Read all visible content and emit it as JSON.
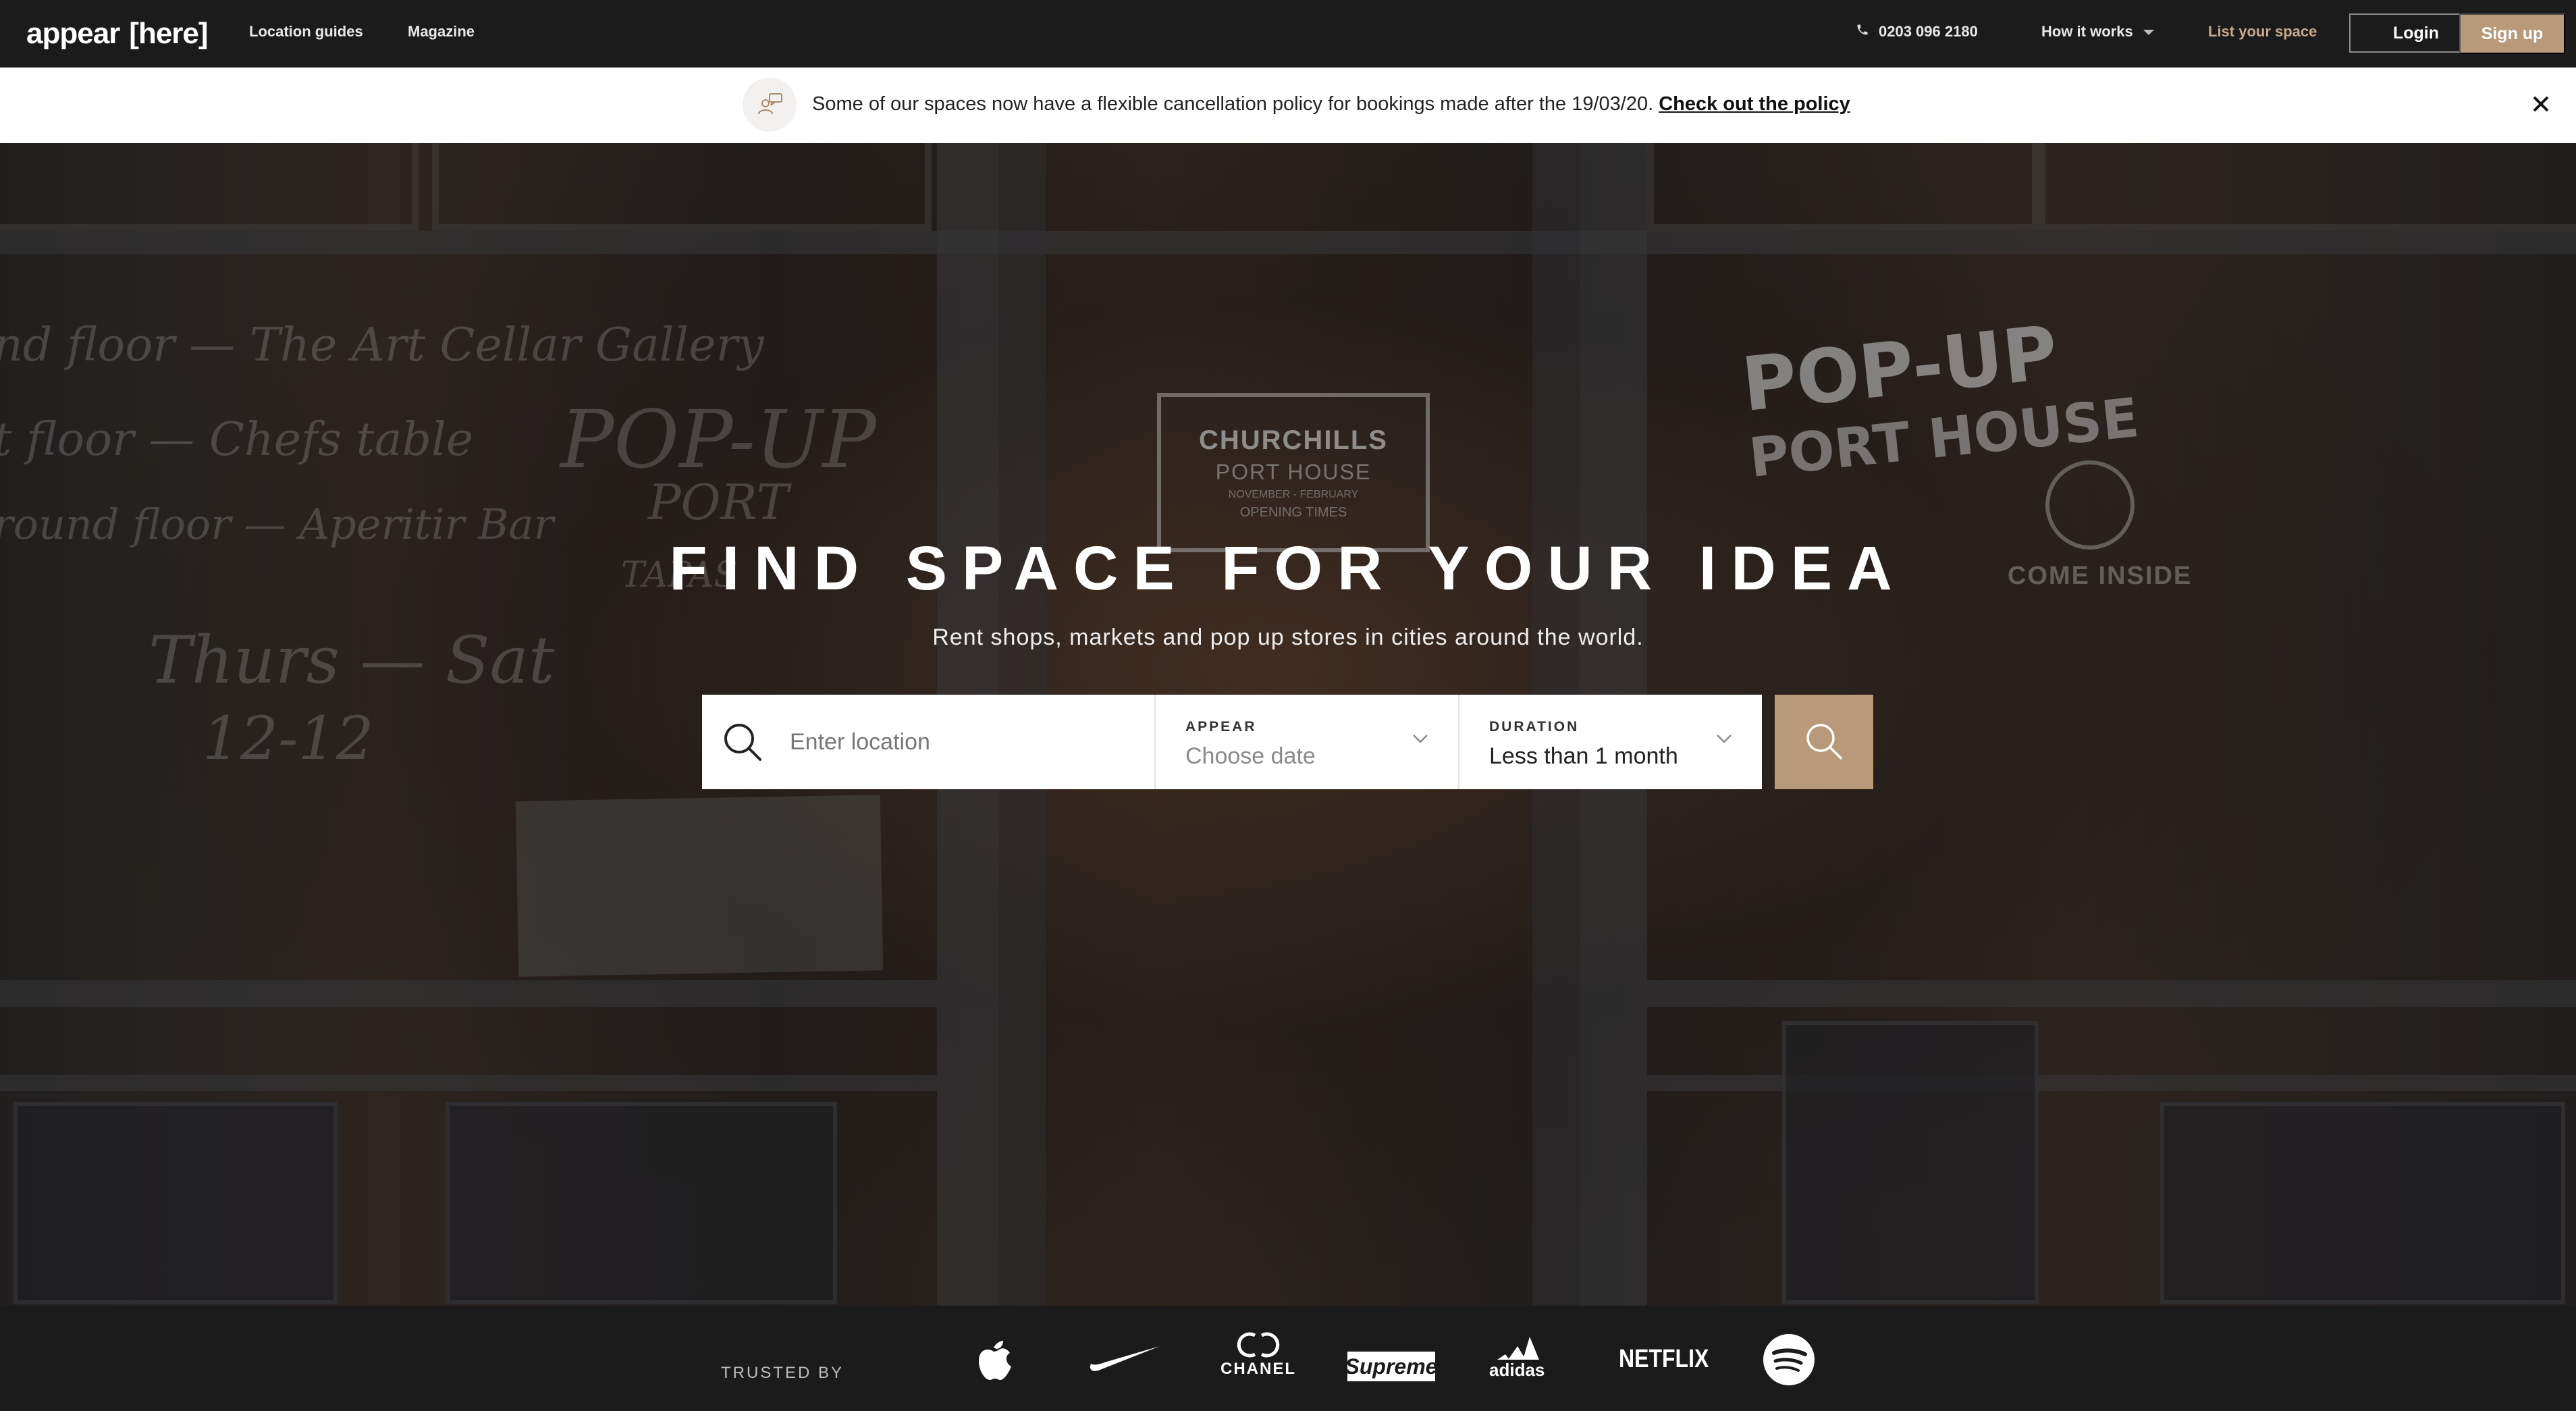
{
  "header": {
    "logo_word": "appear",
    "logo_bracket": "[here]",
    "nav": [
      "Location guides",
      "Magazine"
    ],
    "phone": "0203 096 2180",
    "how_it_works": "How it works",
    "list_space": "List your space",
    "login": "Login",
    "signup": "Sign up"
  },
  "notice": {
    "text": "Some of our spaces now have a flexible cancellation policy for bookings made after the 19/03/20.",
    "link": "Check out the policy"
  },
  "hero": {
    "title": "FIND SPACE FOR YOUR IDEA",
    "subtitle": "Rent shops, markets and pop up stores in cities around the world.",
    "chalk_left": [
      "nd floor — The Art Cellar Gallery",
      "t floor — Chefs table",
      "round floor — Aperitir Bar",
      "Thurs — Sat",
      "12-12"
    ],
    "chalk_mid": [
      "POP-UP",
      "PORT",
      "TAPAS"
    ],
    "sign_title": "CHURCHILLS",
    "sign_sub": "PORT HOUSE",
    "sign_dates": "NOVEMBER - FEBRUARY",
    "sign_times": "OPENING TIMES",
    "popup_line1": "POP-UP",
    "popup_line2": "PORT HOUSE",
    "come_inside": "COME INSIDE"
  },
  "search": {
    "location_placeholder": "Enter location",
    "appear_label": "APPEAR",
    "appear_placeholder": "Choose date",
    "duration_label": "DURATION",
    "duration_value": "Less than 1 month"
  },
  "trusted": {
    "label": "TRUSTED BY",
    "brands": [
      "Apple",
      "Nike",
      "CHANEL",
      "Supreme",
      "adidas",
      "NETFLIX",
      "Spotify"
    ]
  },
  "colors": {
    "accent": "#b89a7a",
    "list_space": "#c8a98a",
    "header_bg": "#1b1b1b"
  }
}
